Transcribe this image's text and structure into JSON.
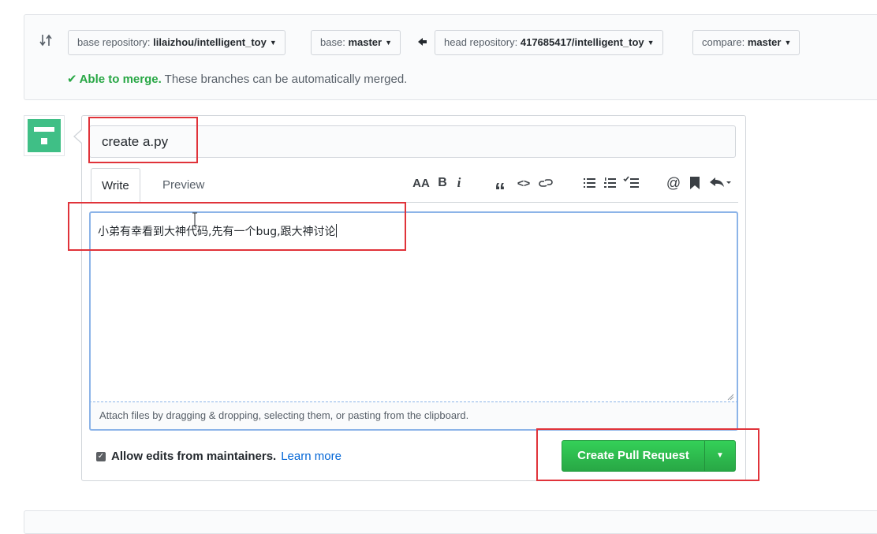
{
  "range": {
    "base_repo_prefix": "base repository:",
    "base_repo_value": "lilaizhou/intelligent_toy",
    "base_prefix": "base:",
    "base_value": "master",
    "head_repo_prefix": "head repository:",
    "head_repo_value": "417685417/intelligent_toy",
    "compare_prefix": "compare:",
    "compare_value": "master",
    "merge_ok": "Able to merge.",
    "merge_detail": " These branches can be automatically merged."
  },
  "form": {
    "title_value": "create a.py",
    "tabs": [
      "Write",
      "Preview"
    ],
    "body_text": "小弟有幸看到大神代码,先有一个bug,跟大神讨论",
    "attach_hint": "Attach files by dragging & dropping, selecting them, or pasting from the clipboard.",
    "allow_edits_label": "Allow edits from maintainers.",
    "learn_more": "Learn more",
    "submit_label": "Create Pull Request"
  },
  "toolbar": {
    "icons": [
      "text-size-icon",
      "bold-icon",
      "italic-icon",
      "quote-icon",
      "code-icon",
      "link-icon",
      "bullet-list-icon",
      "numbered-list-icon",
      "task-list-icon",
      "mention-icon",
      "saved-reply-icon",
      "reply-icon"
    ],
    "text_size": "AA",
    "bold": "B",
    "italic": "i",
    "quote": "“",
    "code": "<>",
    "mention": "@"
  },
  "colors": {
    "accent_green": "#28a745",
    "link_blue": "#0366d6",
    "highlight_red": "#e0333a",
    "focus_blue": "#8cb4e8"
  }
}
